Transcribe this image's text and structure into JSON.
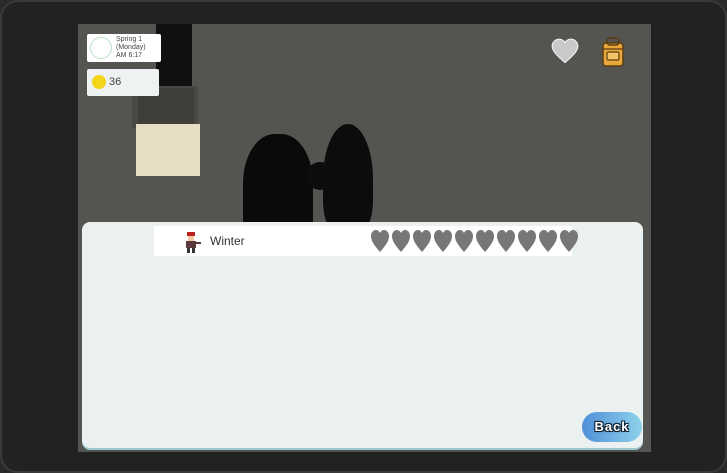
{
  "hud": {
    "date_lines": "Spring 1\n(Monday)\nAM 6:17",
    "gold": "36"
  },
  "social": {
    "villagers": [
      {
        "name": "Winter",
        "hearts_filled": 0,
        "hearts_total": 10
      }
    ]
  },
  "buttons": {
    "back_label": "Back"
  },
  "colors": {
    "heart_empty": "#777777",
    "gold_coin": "#f4d51a",
    "back_button_start": "#4f8fd8",
    "back_button_end": "#8fd2ea"
  },
  "icons": {
    "clock": "clock-icon",
    "coin": "coin-icon",
    "favorite": "heart-icon",
    "inventory": "backpack-icon",
    "villager": "villager-portrait-icon"
  }
}
